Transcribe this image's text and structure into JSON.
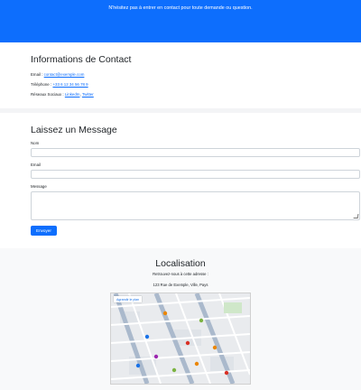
{
  "hero": {
    "tagline": "N'hésitez pas à entrer en contact pour toute demande ou question."
  },
  "contact": {
    "title": "Informations de Contact",
    "email_label": "Email :",
    "email_value": "contact@exemple.com",
    "phone_label": "Téléphone :",
    "phone_value": "+33 6 12 34 56 78 9",
    "social_label": "Réseaux Sociaux :",
    "social_links": [
      "LinkedIn",
      "Twitter"
    ]
  },
  "form": {
    "title": "Laissez un Message",
    "name_label": "Nom",
    "email_label": "Email",
    "message_label": "Message",
    "submit_label": "Envoyer"
  },
  "location": {
    "title": "Localisation",
    "intro": "Retrouvez-nous à cette adresse :",
    "address": "123 Rue de Exemple, Ville, Pays",
    "map_link": "Agrandir le plan"
  },
  "colors": {
    "primary": "#0d6efd",
    "section_bg": "#f8f9fa"
  }
}
